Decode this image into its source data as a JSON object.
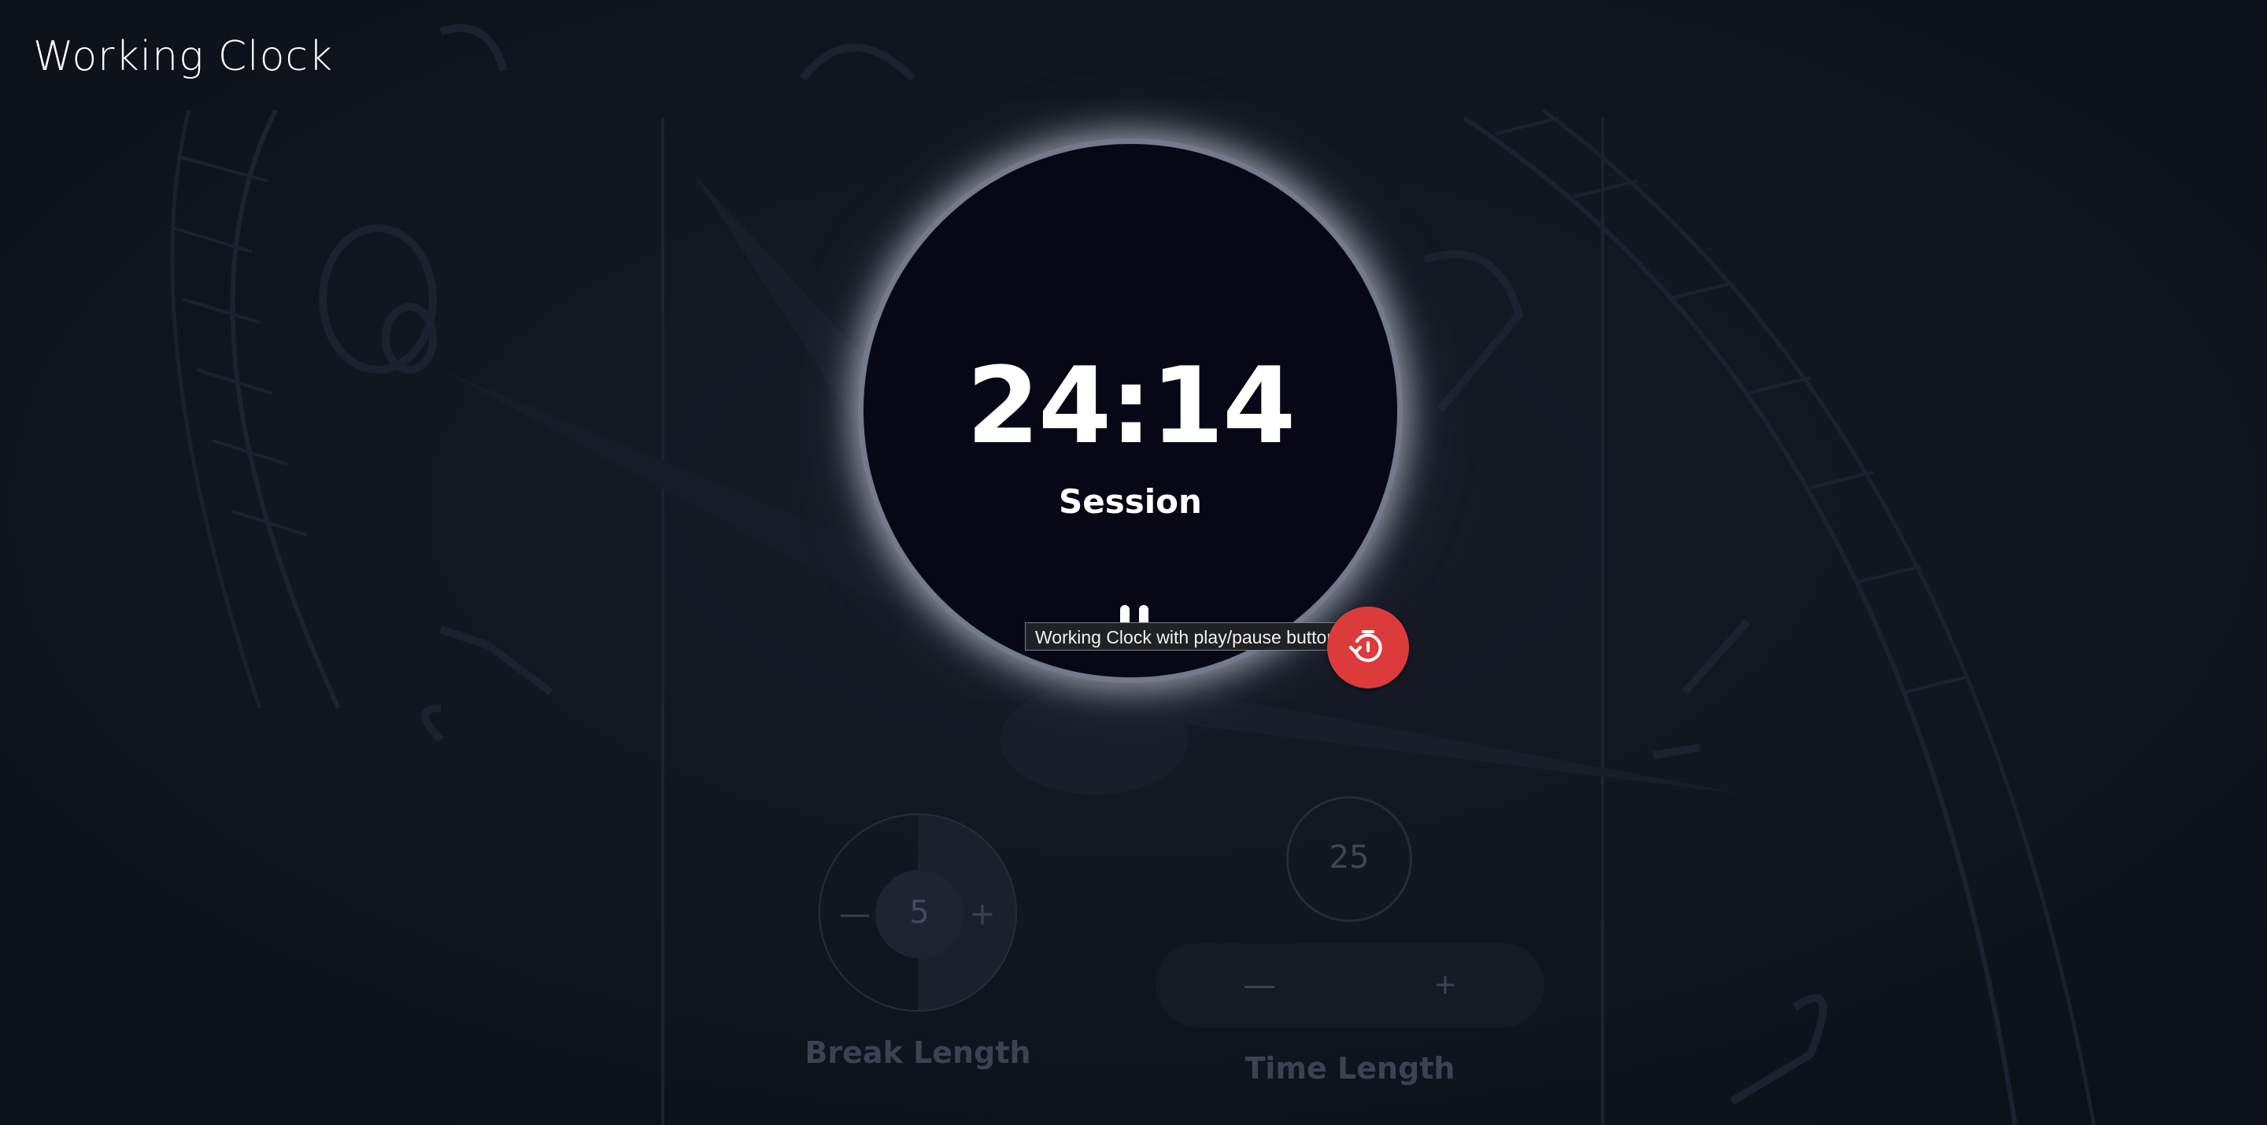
{
  "app": {
    "title": "Working Clock"
  },
  "clock": {
    "time": "24:14",
    "mode_label": "Session",
    "state": "running",
    "play_pause_icon": "pause-icon",
    "tooltip": "Working Clock with play/pause button"
  },
  "reset_button": {
    "icon": "stopwatch-reset-icon",
    "color": "#dc3b3b"
  },
  "break_control": {
    "value": "5",
    "decrement_label": "—",
    "increment_label": "+",
    "title": "Break Length"
  },
  "time_control": {
    "value": "25",
    "decrement_label": "—",
    "increment_label": "+",
    "title": "Time Length"
  },
  "colors": {
    "background": "#121722",
    "clock_face": "#060915",
    "clock_ring": "#737a8b",
    "accent_red": "#dc3b3b"
  }
}
